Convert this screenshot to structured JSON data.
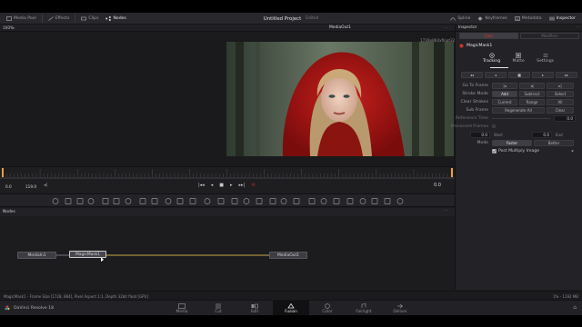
{
  "topbar": {
    "left": [
      {
        "icon": "media-pool-icon",
        "label": "Media Pool"
      },
      {
        "icon": "effects-icon",
        "label": "Effects"
      },
      {
        "icon": "clips-icon",
        "label": "Clips"
      },
      {
        "icon": "nodes-icon",
        "label": "Nodes"
      }
    ],
    "project_title": "Untitled Project",
    "project_status": "Edited",
    "right": [
      {
        "icon": "spline-icon",
        "label": "Spline"
      },
      {
        "icon": "keyframes-icon",
        "label": "Keyframes"
      },
      {
        "icon": "metadata-icon",
        "label": "Metadata"
      },
      {
        "icon": "inspector-icon",
        "label": "Inspector"
      }
    ]
  },
  "viewer": {
    "zoom": "100%",
    "title": "MediaOut1",
    "resolution": "1728x864xfloat32"
  },
  "timeline": {
    "current_frame": "0.0",
    "end_frame": "119.0",
    "right_value": "0.0"
  },
  "nodes": {
    "header": "Nodes",
    "items": [
      {
        "id": "media-in",
        "label": "MediaIn1"
      },
      {
        "id": "magic-mask",
        "label": "MagicMask1"
      },
      {
        "id": "media-out",
        "label": "MediaOut1"
      }
    ]
  },
  "inspector": {
    "header": "Inspector",
    "tabs": [
      "Tools",
      "Modifiers"
    ],
    "node_name": "MagicMask1",
    "subtabs": [
      "Tracking",
      "Matte",
      "Settings"
    ],
    "rows": {
      "go_to_frame": "Go To Frame",
      "stroke_mode": "Stroke Mode",
      "stroke_mode_options": [
        "Add",
        "Subtract",
        "Select"
      ],
      "clear_strokes": "Clear Strokes",
      "clear_strokes_options": [
        "Current",
        "Range",
        "All"
      ],
      "sub_frame": "Sub Frame",
      "regenerate": "Regenerate All",
      "clear": "Clear",
      "reference_time": "Reference Time",
      "reference_value": "0.0",
      "processed_frames": "Processed Frames",
      "start_value": "0.0",
      "start_label": "Start",
      "end_value": "0.0",
      "end_label": "End",
      "mode": "Mode",
      "mode_options": [
        "Faster",
        "Better"
      ],
      "premultiply": "Post Multiply Image"
    }
  },
  "status": {
    "left": "MagicMask1 - Frame Size [1728, 864], Pixel Aspect 1:1, Depth 32bit float [GPU]",
    "right": "1% - 1192 MB"
  },
  "app": {
    "name": "DaVinci Resolve 18"
  },
  "pages": [
    {
      "label": "Media",
      "icon": "media-page-icon"
    },
    {
      "label": "Cut",
      "icon": "cut-page-icon"
    },
    {
      "label": "Edit",
      "icon": "edit-page-icon"
    },
    {
      "label": "Fusion",
      "icon": "fusion-page-icon",
      "active": true
    },
    {
      "label": "Color",
      "icon": "color-page-icon"
    },
    {
      "label": "Fairlight",
      "icon": "fairlight-page-icon"
    },
    {
      "label": "Deliver",
      "icon": "deliver-page-icon"
    }
  ],
  "colors": {
    "accent": "#d0332a",
    "active": "#e8a23a",
    "link": "#c8a84a"
  }
}
